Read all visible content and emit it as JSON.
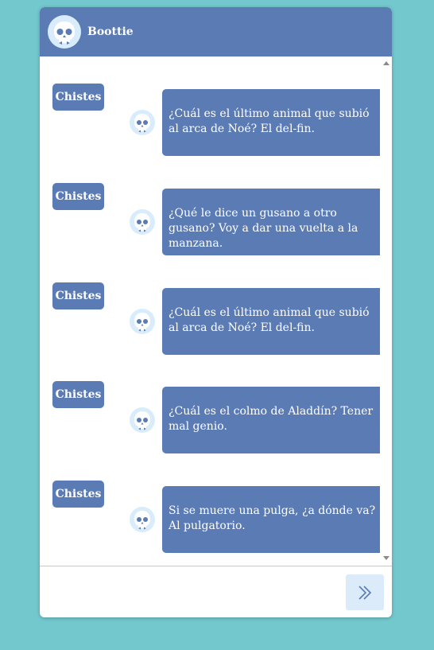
{
  "header": {
    "title": "Boottie",
    "avatar_icon": "robot-skull-icon"
  },
  "messages": [
    {
      "user_label": "Chistes",
      "bot_text": "¿Cuál es el último animal que subió al arca de Noé? El del-fin."
    },
    {
      "user_label": "Chistes",
      "bot_text": "¿Qué le dice un gusano a otro gusano? Voy a dar una vuelta a la manzana."
    },
    {
      "user_label": "Chistes",
      "bot_text": "¿Cuál es el último animal que subió al arca de Noé? El del-fin."
    },
    {
      "user_label": "Chistes",
      "bot_text": "¿Cuál es el colmo de Aladdín? Tener mal genio."
    },
    {
      "user_label": "Chistes",
      "bot_text": "Si se muere una pulga, ¿a dónde va? Al pulgatorio."
    }
  ],
  "composer": {
    "send_icon": "double-chevron-right-icon"
  },
  "colors": {
    "background": "#72c8cc",
    "accent": "#5b7bb5",
    "send_button_bg": "#dcebfa"
  }
}
